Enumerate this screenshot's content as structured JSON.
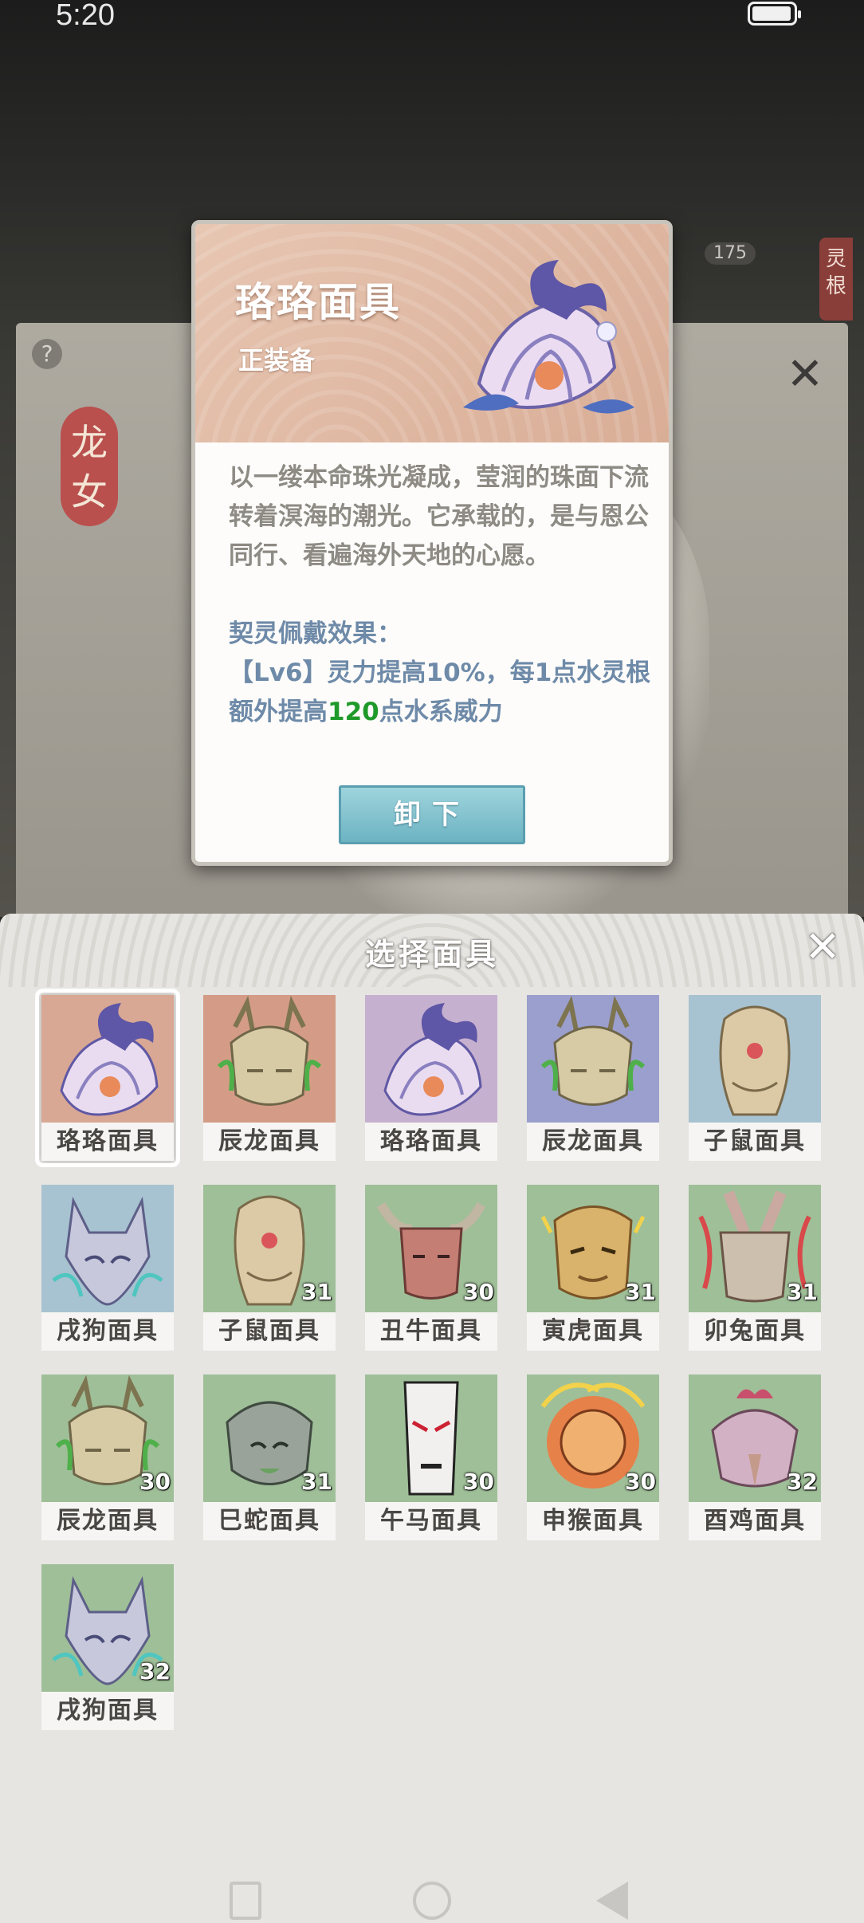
{
  "status_bar": {
    "time": "5:20"
  },
  "background": {
    "hero_name": "龙女",
    "counter": "175",
    "side_tag": "灵根",
    "help": "?",
    "close_glyph": "✕"
  },
  "popup": {
    "title": "珞珞面具",
    "subtitle": "正装备",
    "description": "以一缕本命珠光凝成，莹润的珠面下流转着溟海的潮光。它承载的，是与恩公同行、看遍海外天地的心愿。",
    "effect_title": "契灵佩戴效果：",
    "effect_prefix": "【Lv6】灵力提高10%，每1点水灵根额外提高",
    "effect_value": "120",
    "effect_suffix": "点水系威力",
    "button": "卸下"
  },
  "sheet": {
    "title": "选择面具",
    "close_glyph": "✕",
    "masks": [
      {
        "label": "珞珞面具",
        "level": "",
        "kind": "pearl",
        "bg": "#d8a895",
        "selected": true
      },
      {
        "label": "辰龙面具",
        "level": "",
        "kind": "dragon",
        "bg": "#d49c86",
        "selected": false
      },
      {
        "label": "珞珞面具",
        "level": "",
        "kind": "pearl",
        "bg": "#c6b0cf",
        "selected": false
      },
      {
        "label": "辰龙面具",
        "level": "",
        "kind": "dragon",
        "bg": "#9b9fcd",
        "selected": false
      },
      {
        "label": "子鼠面具",
        "level": "",
        "kind": "rat",
        "bg": "#a7c2d0",
        "selected": false
      },
      {
        "label": "戌狗面具",
        "level": "",
        "kind": "dog",
        "bg": "#a7c2d0",
        "selected": false
      },
      {
        "label": "子鼠面具",
        "level": "31",
        "kind": "rat",
        "bg": "#9fbf98",
        "selected": false
      },
      {
        "label": "丑牛面具",
        "level": "30",
        "kind": "ox",
        "bg": "#9fbf98",
        "selected": false
      },
      {
        "label": "寅虎面具",
        "level": "31",
        "kind": "tiger",
        "bg": "#9fbf98",
        "selected": false
      },
      {
        "label": "卯兔面具",
        "level": "31",
        "kind": "rabbit",
        "bg": "#9fbf98",
        "selected": false
      },
      {
        "label": "辰龙面具",
        "level": "30",
        "kind": "dragon",
        "bg": "#9fbf98",
        "selected": false
      },
      {
        "label": "巳蛇面具",
        "level": "31",
        "kind": "snake",
        "bg": "#9fbf98",
        "selected": false
      },
      {
        "label": "午马面具",
        "level": "30",
        "kind": "horse",
        "bg": "#9fbf98",
        "selected": false
      },
      {
        "label": "申猴面具",
        "level": "30",
        "kind": "monkey",
        "bg": "#9fbf98",
        "selected": false
      },
      {
        "label": "酉鸡面具",
        "level": "32",
        "kind": "rooster",
        "bg": "#9fbf98",
        "selected": false
      },
      {
        "label": "戌狗面具",
        "level": "32",
        "kind": "dog",
        "bg": "#9fbf98",
        "selected": false
      }
    ]
  },
  "colors": {
    "effect_text": "#6e8aa8",
    "effect_value": "#1f9a2a",
    "button": "#7fc2cf"
  }
}
